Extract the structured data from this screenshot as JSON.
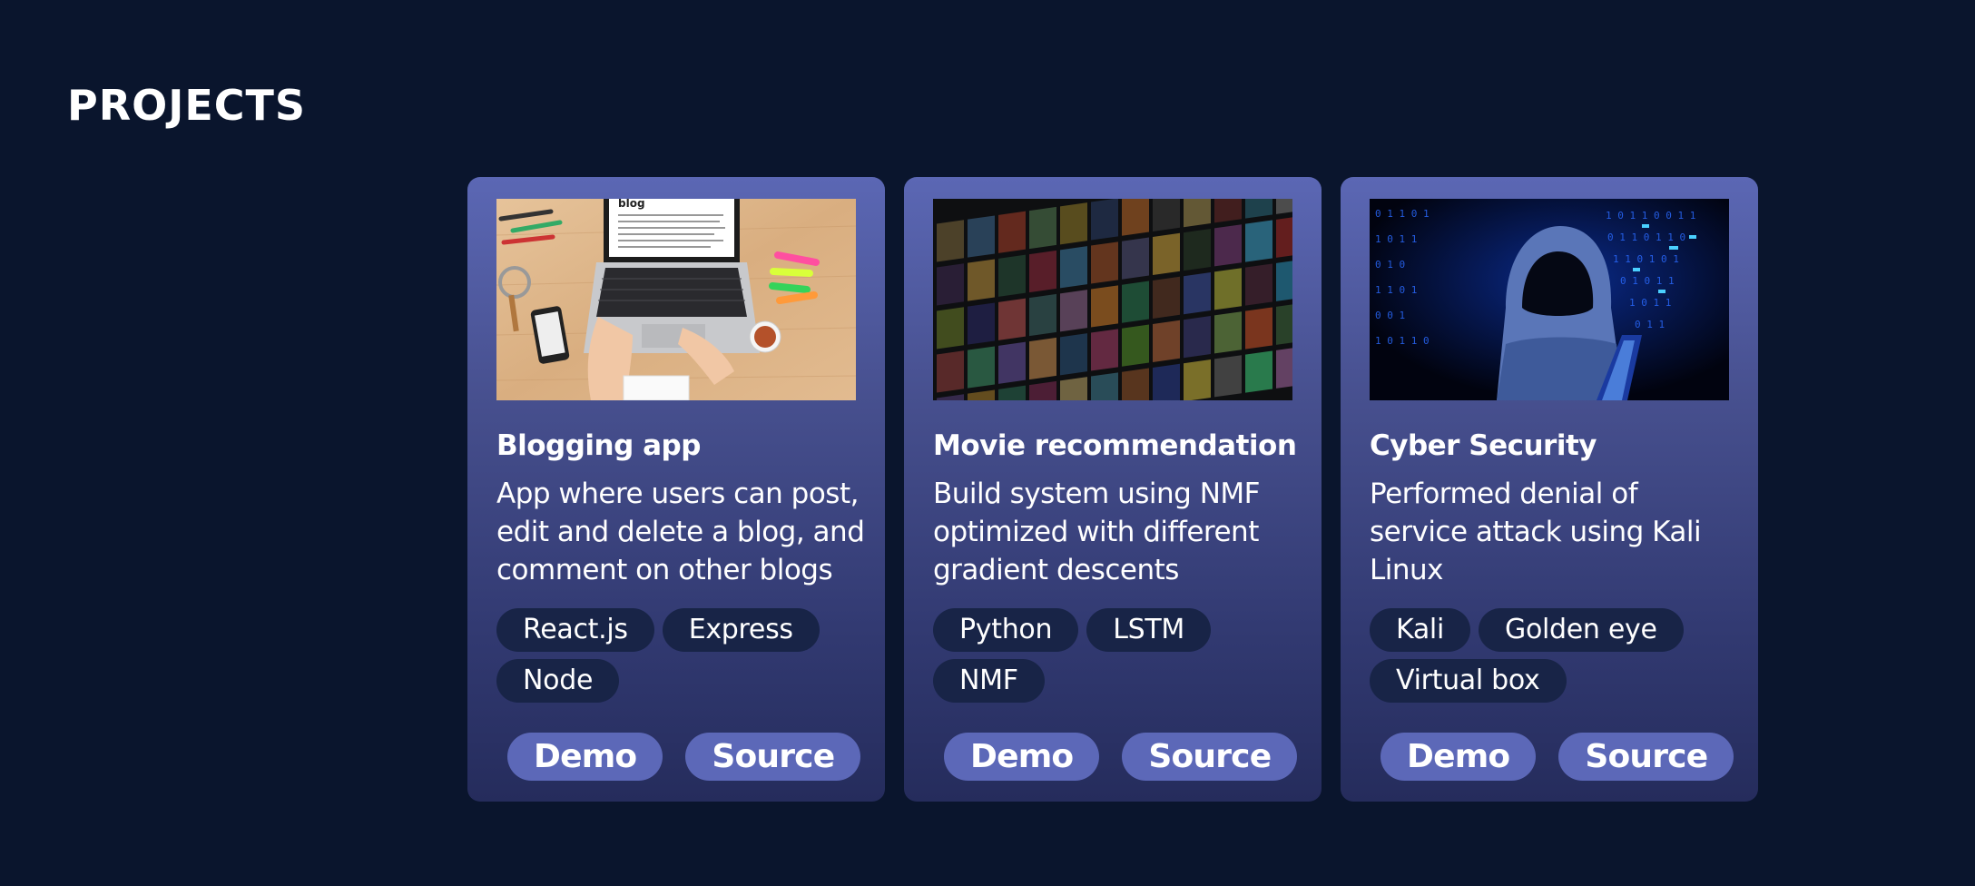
{
  "section": {
    "title": "PROJECTS"
  },
  "projects": [
    {
      "title": "Blogging app",
      "description": "App where users can post, edit and delete a blog, and comment on other blogs",
      "image": "blog-laptop-photo",
      "image_text": "blog",
      "tags": [
        "React.js",
        "Express",
        "Node"
      ],
      "demo_label": "Demo",
      "source_label": "Source"
    },
    {
      "title": "Movie recommendation",
      "description": "Build system using NMF optimized with different gradient descents",
      "image": "movie-posters-wall-photo",
      "tags": [
        "Python",
        "LSTM",
        "NMF"
      ],
      "demo_label": "Demo",
      "source_label": "Source"
    },
    {
      "title": "Cyber Security",
      "description": "Performed denial of service attack using Kali Linux",
      "image": "hooded-hacker-photo",
      "tags": [
        "Kali",
        "Golden eye",
        "Virtual box"
      ],
      "demo_label": "Demo",
      "source_label": "Source"
    }
  ],
  "colors": {
    "page_background": "#0a152d",
    "card_top": "#5b67b4",
    "card_bottom": "#252c5c",
    "tag_background": "#182447",
    "button_background": "#5c68b8"
  }
}
